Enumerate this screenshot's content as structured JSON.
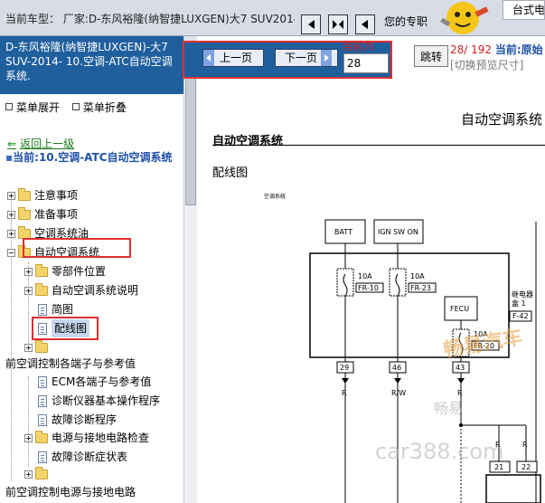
{
  "topbar": {
    "vehicle_label": "当前车型： 厂家:D-东风裕隆(纳智捷LUXGEN)大7 SUV2014",
    "user_text": "您的专职",
    "desktop_text": "台式电"
  },
  "sidebar": {
    "doc_header": "D-东风裕隆(纳智捷LUXGEN)-大7 SUV-2014- 10.空调-ATC自动空调系统.",
    "expand_label": "菜单展开",
    "collapse_label": "菜单折叠",
    "back_label": "返回上一级",
    "current_label": "当前:10.空调-ATC自动空调系统",
    "tree": [
      {
        "label": "注意事项"
      },
      {
        "label": "准备事项"
      },
      {
        "label": "空调系统油"
      },
      {
        "label": "自动空调系统"
      },
      {
        "label": "零部件位置"
      },
      {
        "label": "自动空调系统说明"
      },
      {
        "label": "简图"
      },
      {
        "label": "配线图"
      },
      {
        "label": ""
      },
      {
        "label": "前空调控制各端子与参考值"
      },
      {
        "label": "ECM各端子与参考值"
      },
      {
        "label": "诊断仪器基本操作程序"
      },
      {
        "label": "故障诊断程序"
      },
      {
        "label": "电源与接地电路检查"
      },
      {
        "label": "故障诊断症状表"
      },
      {
        "label": ""
      },
      {
        "label": "前空调控制电源与接地电路"
      }
    ]
  },
  "toolbar": {
    "prev_label": "上一页",
    "next_label": "下一页",
    "current_page_label": "当前为",
    "page_value": "28",
    "jump_label": "跳转",
    "page_count": "28/ 192",
    "current_mode_prefix": "当前:",
    "current_mode": "原始",
    "preview_size_label": "[切换预览尺寸]"
  },
  "document": {
    "system_title": "自动空调系统",
    "section_title": "自动空调系统",
    "sub_title": "配线图",
    "small_label": "空调系统",
    "labels": {
      "batt": "BATT",
      "ign": "IGN SW ON",
      "fuse1_amp": "10A",
      "fuse1_id": "FR-10",
      "fuse2_amp": "10A",
      "fuse2_id": "FR-23",
      "fecu": "FECU",
      "relay_box_1": "继电器",
      "relay_box_2": "盒 1",
      "relay_box_id": "F-42",
      "fuse3_amp": "10A",
      "fuse3_id": "FR-20",
      "pin1": "29",
      "pin2": "46",
      "pin3": "43",
      "wire1": "R",
      "wire2": "R/W",
      "wire3": "R",
      "wire4": "R",
      "wire5": "R",
      "conn1": "21",
      "conn2": "22"
    },
    "watermarks": [
      "畅易汽车",
      "畅易",
      "car388.com"
    ]
  },
  "colors": {
    "header_blue": "#1f5f9e",
    "highlight_red": "#e03030",
    "link_green": "#1a7a1a",
    "current_blue": "#1e50a8"
  }
}
